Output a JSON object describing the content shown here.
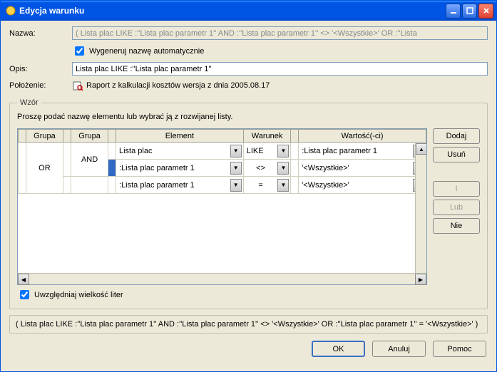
{
  "window": {
    "title": "Edycja warunku"
  },
  "labels": {
    "name": "Nazwa:",
    "desc": "Opis:",
    "loc": "Położenie:",
    "auto_gen": "Wygeneruj nazwę automatycznie",
    "case": "Uwzględniaj wielkość liter"
  },
  "fields": {
    "name_value": "( Lista plac LIKE :''Lista plac parametr 1'' AND :''Lista plac parametr 1'' <> '<Wszystkie>' OR :''Lista",
    "desc_value": "Lista plac LIKE :''Lista plac parametr 1''",
    "loc_value": "Raport z kalkulacji kosztów wersja z dnia 2005.08.17"
  },
  "pattern": {
    "legend": "Wzór",
    "prompt": "Proszę podać nazwę elementu lub wybrać ją z rozwijanej listy."
  },
  "headers": {
    "grupa": "Grupa",
    "element": "Element",
    "warunek": "Warunek",
    "wartosc": "Wartość(-ci)"
  },
  "groups": {
    "outer": "OR",
    "inner": "AND"
  },
  "rows": [
    {
      "element": "Lista plac",
      "warunek": "LIKE",
      "wartosc": ":Lista plac parametr 1"
    },
    {
      "element": ":Lista plac parametr 1",
      "warunek": "<>",
      "wartosc": "'<Wszystkie>'"
    },
    {
      "element": ":Lista plac parametr 1",
      "warunek": "=",
      "wartosc": "'<Wszystkie>'"
    }
  ],
  "side_buttons": {
    "dodaj": "Dodaj",
    "usun": "Usuń",
    "i": "I",
    "lub": "Lub",
    "nie": "Nie"
  },
  "summary": "( Lista plac LIKE :''Lista plac parametr 1'' AND :''Lista plac parametr 1'' <> '<Wszystkie>' OR :''Lista plac parametr 1'' = '<Wszystkie>' )",
  "footer": {
    "ok": "OK",
    "cancel": "Anuluj",
    "help": "Pomoc"
  }
}
